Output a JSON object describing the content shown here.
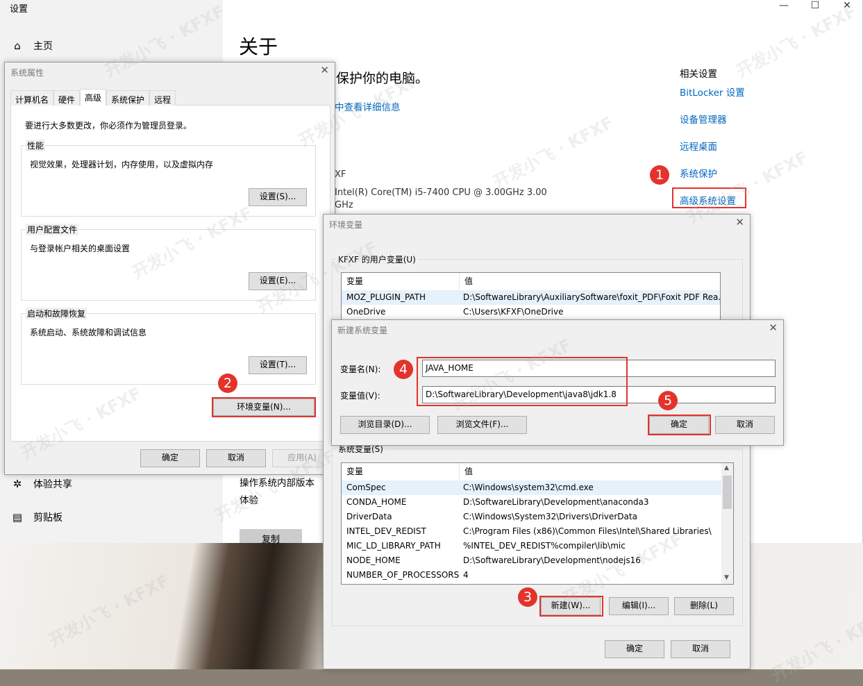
{
  "settings": {
    "title": "设置",
    "controls": {
      "minimize": "—",
      "maximize": "☐",
      "close": "✕"
    },
    "nav": {
      "home": "主页",
      "shared": "体验共享",
      "clipboard": "剪贴板"
    },
    "about_title": "关于",
    "protect_text": "保护你的电脑。",
    "details_link": "中查看详细信息",
    "device_name": "XF",
    "processor": "Intel(R) Core(TM) i5-7400 CPU @ 3.00GHz   3.00",
    "processor_unit": "GHz",
    "os_build": "操作系统内部版本",
    "experience": "体验",
    "copy_button": "复制",
    "related": {
      "heading": "相关设置",
      "links": [
        "BitLocker 设置",
        "设备管理器",
        "远程桌面",
        "系统保护",
        "高级系统设置"
      ]
    }
  },
  "sysprop": {
    "title": "系统属性",
    "tabs": [
      "计算机名",
      "硬件",
      "高级",
      "系统保护",
      "远程"
    ],
    "admin_note": "要进行大多数更改，你必须作为管理员登录。",
    "performance": {
      "label": "性能",
      "desc": "视觉效果，处理器计划，内存使用，以及虚拟内存",
      "button": "设置(S)..."
    },
    "profiles": {
      "label": "用户配置文件",
      "desc": "与登录帐户相关的桌面设置",
      "button": "设置(E)..."
    },
    "startup": {
      "label": "启动和故障恢复",
      "desc": "系统启动、系统故障和调试信息",
      "button": "设置(T)..."
    },
    "env_button": "环境变量(N)...",
    "ok": "确定",
    "cancel": "取消",
    "apply": "应用(A)"
  },
  "envvars": {
    "title": "环境变量",
    "user_label": "KFXF 的用户变量(U)",
    "col_var": "变量",
    "col_val": "值",
    "user_rows": [
      {
        "name": "MOZ_PLUGIN_PATH",
        "value": "D:\\SoftwareLibrary\\AuxiliarySoftware\\foxit_PDF\\Foxit PDF Rea..."
      },
      {
        "name": "OneDrive",
        "value": "C:\\Users\\KFXF\\OneDrive"
      }
    ],
    "sys_label": "系统变量(S)",
    "sys_rows": [
      {
        "name": "ComSpec",
        "value": "C:\\Windows\\system32\\cmd.exe"
      },
      {
        "name": "CONDA_HOME",
        "value": "D:\\SoftwareLibrary\\Development\\anaconda3"
      },
      {
        "name": "DriverData",
        "value": "C:\\Windows\\System32\\Drivers\\DriverData"
      },
      {
        "name": "INTEL_DEV_REDIST",
        "value": "C:\\Program Files (x86)\\Common Files\\Intel\\Shared Libraries\\"
      },
      {
        "name": "MIC_LD_LIBRARY_PATH",
        "value": "%INTEL_DEV_REDIST%compiler\\lib\\mic"
      },
      {
        "name": "NODE_HOME",
        "value": "D:\\SoftwareLibrary\\Development\\nodejs16"
      },
      {
        "name": "NUMBER_OF_PROCESSORS",
        "value": "4"
      }
    ],
    "new_button": "新建(W)...",
    "edit_button": "编辑(I)...",
    "delete_button": "删除(L)",
    "ok": "确定",
    "cancel": "取消"
  },
  "newvar": {
    "title": "新建系统变量",
    "name_label": "变量名(N):",
    "name_value": "JAVA_HOME",
    "value_label": "变量值(V):",
    "value_value": "D:\\SoftwareLibrary\\Development\\java8\\jdk1.8",
    "browse_dir": "浏览目录(D)...",
    "browse_file": "浏览文件(F)...",
    "ok": "确定",
    "cancel": "取消"
  },
  "badges": [
    "1",
    "2",
    "3",
    "4",
    "5"
  ],
  "watermark": "开发小飞 · KFXF",
  "colors": {
    "link": "#0067c0",
    "annotation_red": "#e3332c"
  }
}
